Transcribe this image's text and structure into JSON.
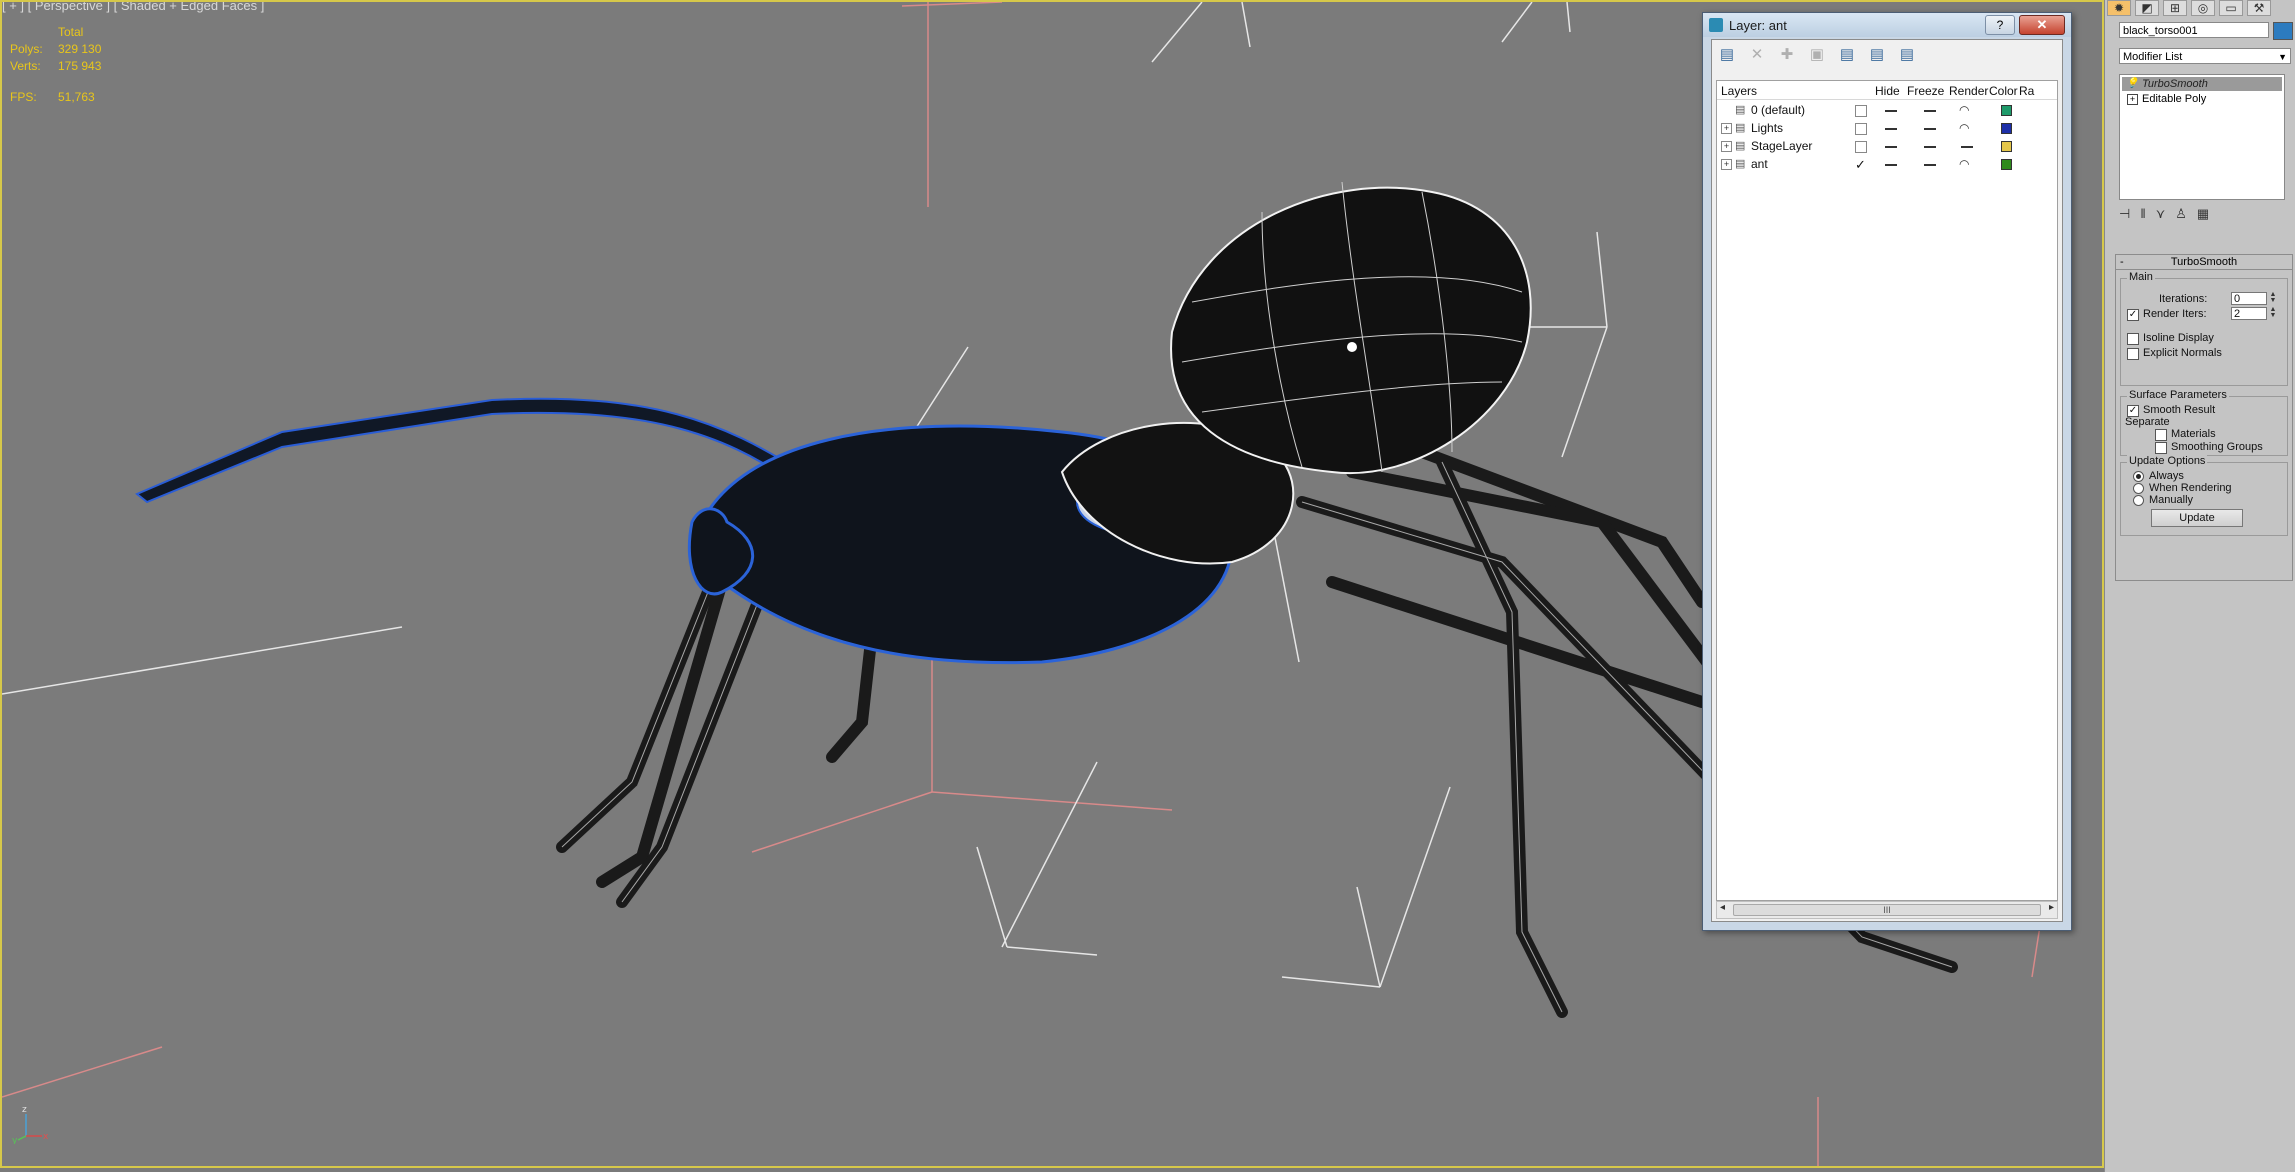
{
  "viewport": {
    "label": "[ + ] [ Perspective ] [ Shaded + Edged Faces ]",
    "stats": {
      "total_label": "Total",
      "polys_label": "Polys:",
      "polys_value": "329 130",
      "verts_label": "Verts:",
      "verts_value": "175 943",
      "fps_label": "FPS:",
      "fps_value": "51,763"
    },
    "axis": {
      "x": "x",
      "y": "y",
      "z": "z"
    }
  },
  "layer_dialog": {
    "title": "Layer: ant",
    "help": "?",
    "close": "✕",
    "toolbar_icons": [
      "new-layer-icon",
      "delete-layer-icon",
      "add-selection-icon",
      "select-objects-icon",
      "highlight-layer-icon",
      "hide-all-icon",
      "freeze-all-icon"
    ],
    "columns": [
      "Layers",
      "Hide",
      "Freeze",
      "Render",
      "Color",
      "Ra"
    ],
    "rows": [
      {
        "name": "0 (default)",
        "expander": "",
        "current": "",
        "color": "#1e9a6a"
      },
      {
        "name": "Lights",
        "expander": "+",
        "current": "",
        "color": "#1d2fa8"
      },
      {
        "name": "StageLayer",
        "expander": "+",
        "current": "",
        "color": "#e4c64a"
      },
      {
        "name": "ant",
        "expander": "+",
        "current": "✓",
        "color": "#2e8a1c"
      }
    ],
    "scroll_thumb": "III"
  },
  "command_panel": {
    "tab_icons": [
      "create-icon",
      "modify-icon",
      "hierarchy-icon",
      "motion-icon",
      "display-icon",
      "utilities-icon"
    ],
    "object_name": "black_torso001",
    "object_color": "#2c7bbf",
    "modifier_list": "Modifier List",
    "stack": [
      {
        "label": "TurboSmooth",
        "selected": true
      },
      {
        "label": "Editable Poly",
        "selected": false
      }
    ],
    "rollout_title": "TurboSmooth",
    "main_group": "Main",
    "iterations_label": "Iterations:",
    "iterations_value": "0",
    "render_iters_label": "Render Iters:",
    "render_iters_value": "2",
    "render_iters_checked": "✓",
    "isoline_label": "Isoline Display",
    "explicit_normals_label": "Explicit Normals",
    "surface_group": "Surface Parameters",
    "smooth_result_label": "Smooth Result",
    "smooth_result_checked": "✓",
    "separate_label": "Separate",
    "materials_label": "Materials",
    "smoothing_groups_label": "Smoothing Groups",
    "update_group": "Update Options",
    "always_label": "Always",
    "when_rendering_label": "When Rendering",
    "manually_label": "Manually",
    "update_button": "Update"
  }
}
